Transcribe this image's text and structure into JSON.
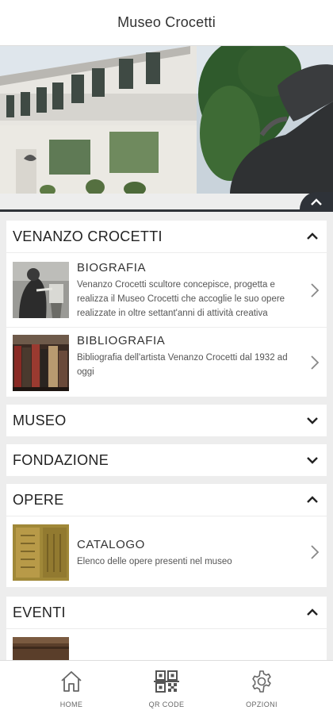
{
  "header": {
    "title": "Museo Crocetti"
  },
  "sections": [
    {
      "title": "VENANZO CROCETTI",
      "expanded": true,
      "items": [
        {
          "title": "BIOGRAFIA",
          "description": "Venanzo Crocetti scultore concepisce, progetta e realizza il Museo Crocetti che accoglie le suo opere realizzate in oltre settant'anni di attività creativa"
        },
        {
          "title": "BIBLIOGRAFIA",
          "description": "Bibliografia dell'artista Venanzo Crocetti dal 1932 ad oggi"
        }
      ]
    },
    {
      "title": "MUSEO",
      "expanded": false
    },
    {
      "title": "FONDAZIONE",
      "expanded": false
    },
    {
      "title": "OPERE",
      "expanded": true,
      "items": [
        {
          "title": "CATALOGO",
          "description": "Elenco delle opere presenti nel museo"
        }
      ]
    },
    {
      "title": "EVENTI",
      "expanded": true
    }
  ],
  "bottom_nav": {
    "home": "HOME",
    "qr": "QR CODE",
    "options": "OPZIONI"
  },
  "colors": {
    "accent_dark": "#2e3238",
    "background": "#ededed"
  }
}
